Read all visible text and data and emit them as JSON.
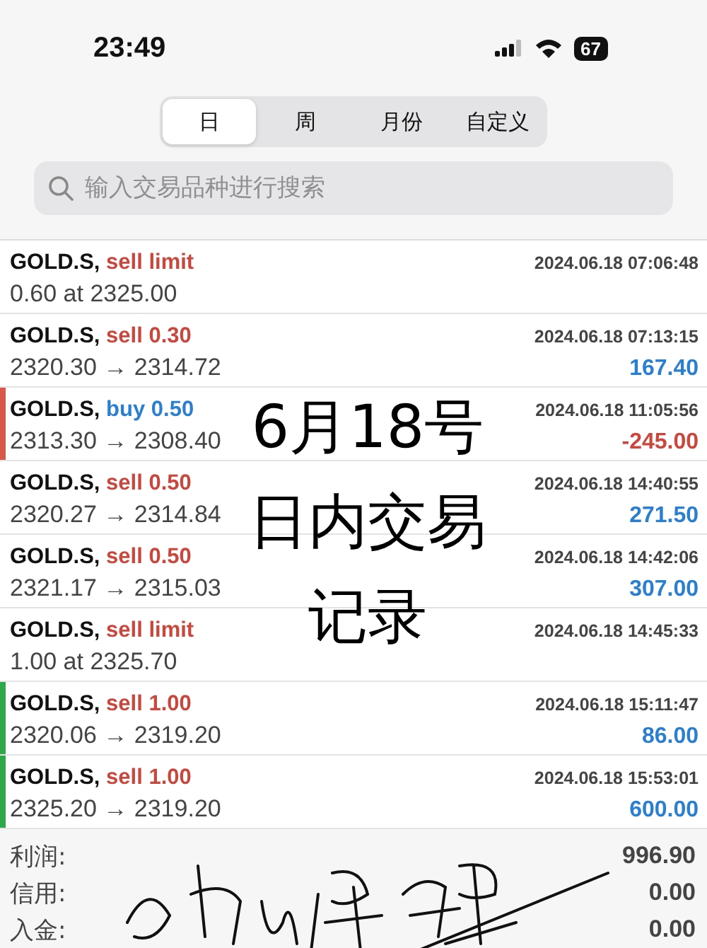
{
  "status_bar": {
    "time": "23:49",
    "battery": "67"
  },
  "tabs": [
    {
      "label": "日",
      "selected": true
    },
    {
      "label": "周",
      "selected": false
    },
    {
      "label": "月份",
      "selected": false
    },
    {
      "label": "自定义",
      "selected": false
    }
  ],
  "search": {
    "placeholder": "输入交易品种进行搜索"
  },
  "trades": [
    {
      "symbol": "GOLD.S,",
      "action": "sell limit",
      "kind": "sell",
      "time": "2024.06.18 07:06:48",
      "detail": "0.60 at 2325.00"
    },
    {
      "symbol": "GOLD.S,",
      "action": "sell 0.30",
      "kind": "sell",
      "time": "2024.06.18 07:13:15",
      "detail": "2320.30 → 2314.72",
      "profit": {
        "text": "167.40",
        "kind": "gain"
      }
    },
    {
      "symbol": "GOLD.S,",
      "action": "buy 0.50",
      "kind": "buy",
      "time": "2024.06.18 11:05:56",
      "detail": "2313.30 → 2308.40",
      "profit": {
        "text": "-245.00",
        "kind": "loss"
      },
      "color": "#d9574a"
    },
    {
      "symbol": "GOLD.S,",
      "action": "sell 0.50",
      "kind": "sell",
      "time": "2024.06.18 14:40:55",
      "detail": "2320.27 → 2314.84",
      "profit": {
        "text": "271.50",
        "kind": "gain"
      }
    },
    {
      "symbol": "GOLD.S,",
      "action": "sell 0.50",
      "kind": "sell",
      "time": "2024.06.18 14:42:06",
      "detail": "2321.17 → 2315.03",
      "profit": {
        "text": "307.00",
        "kind": "gain"
      }
    },
    {
      "symbol": "GOLD.S,",
      "action": "sell limit",
      "kind": "sell",
      "time": "2024.06.18 14:45:33",
      "detail": "1.00 at 2325.70"
    },
    {
      "symbol": "GOLD.S,",
      "action": "sell 1.00",
      "kind": "sell",
      "time": "2024.06.18 15:11:47",
      "detail": "2320.06 → 2319.20",
      "profit": {
        "text": "86.00",
        "kind": "gain"
      },
      "color": "#2fa84a"
    },
    {
      "symbol": "GOLD.S,",
      "action": "sell 1.00",
      "kind": "sell",
      "time": "2024.06.18 15:53:01",
      "detail": "2325.20 → 2319.20",
      "profit": {
        "text": "600.00",
        "kind": "gain"
      },
      "color": "#2fa84a"
    }
  ],
  "summary": [
    {
      "label": "利润:",
      "value": "996.90"
    },
    {
      "label": "信用:",
      "value": "0.00"
    },
    {
      "label": "入金:",
      "value": "0.00"
    }
  ],
  "overlay_caption": [
    "6月18号",
    "日内交易",
    "记录"
  ]
}
